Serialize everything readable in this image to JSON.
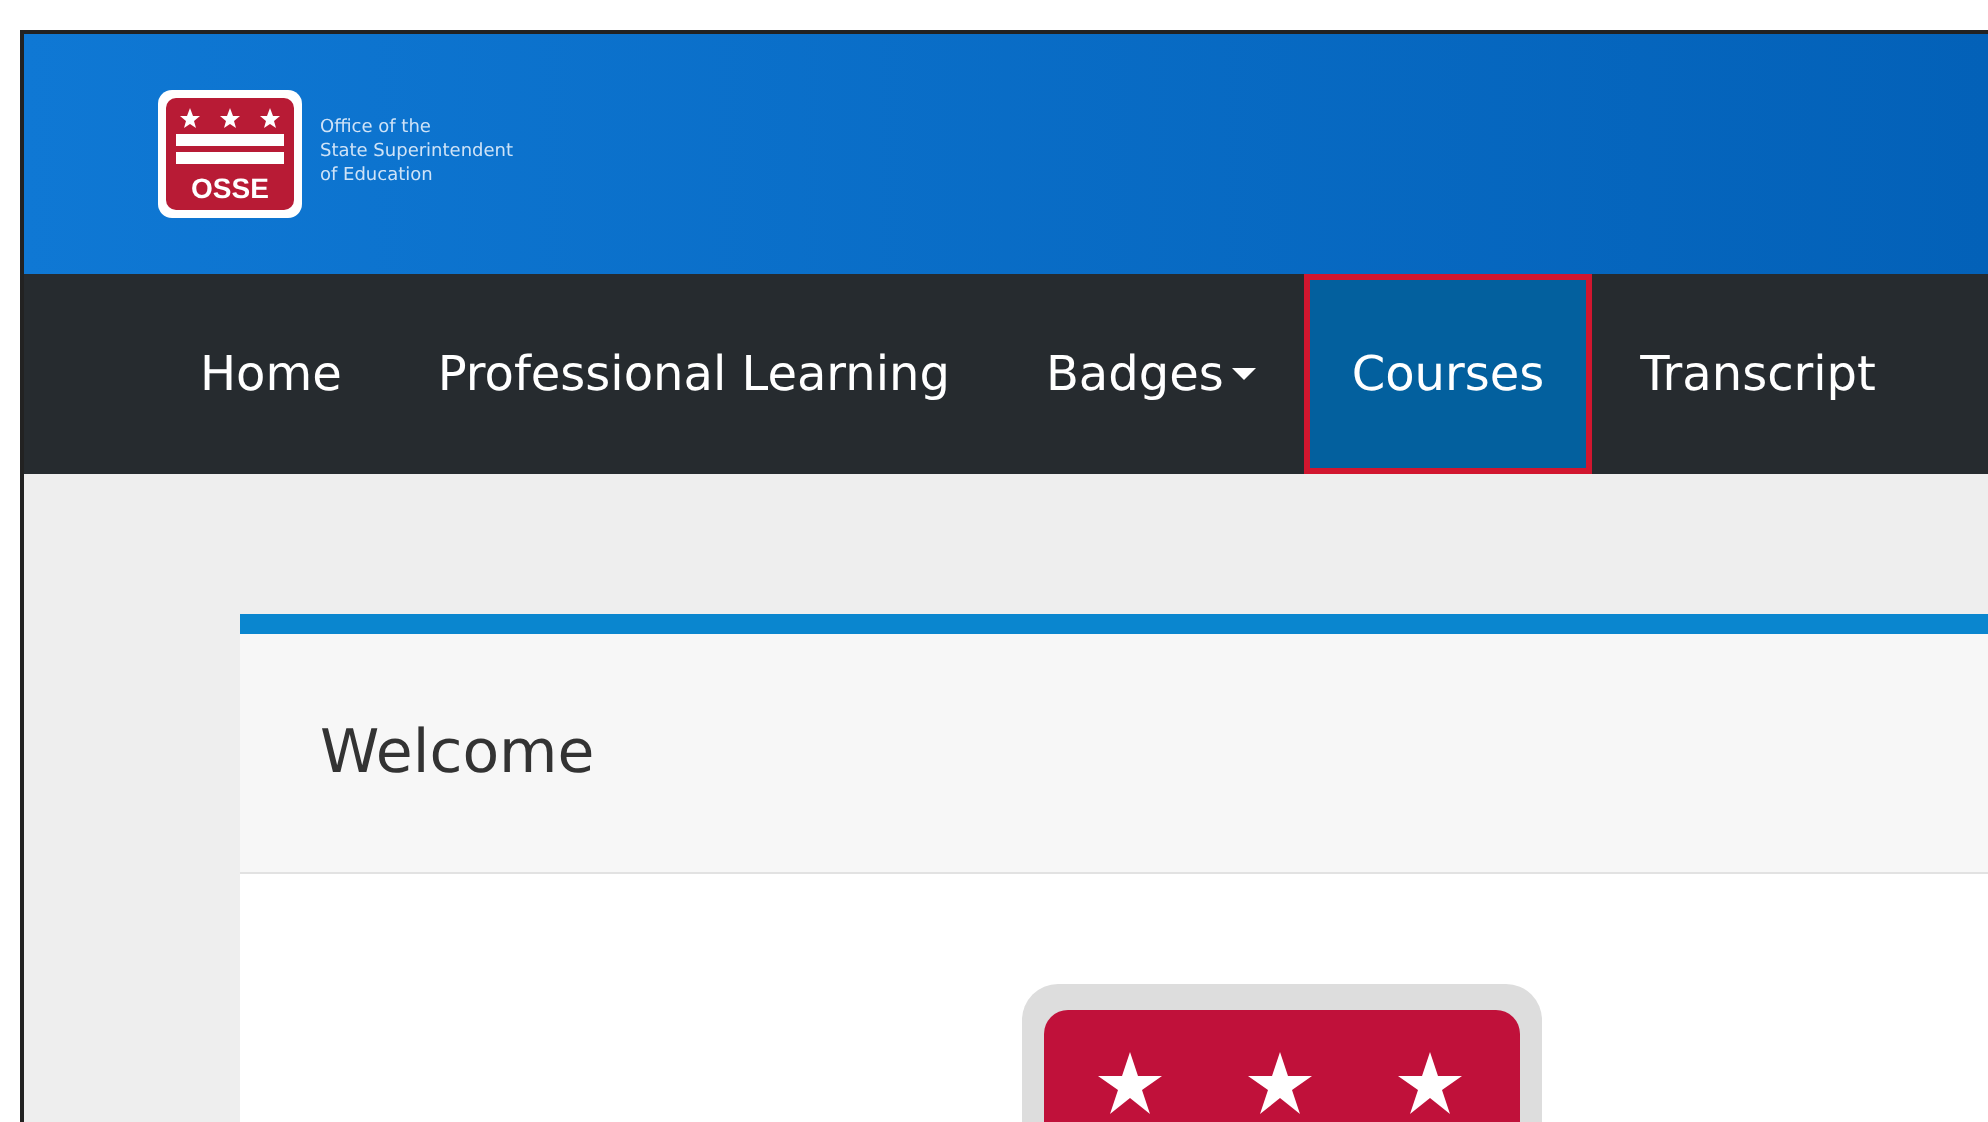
{
  "header": {
    "logo_text": "OSSE",
    "org_lines": [
      "Office of the",
      "State Superintendent",
      "of Education"
    ]
  },
  "nav": [
    {
      "label": "Home",
      "selected": false,
      "highlighted": false,
      "dropdown": false
    },
    {
      "label": "Professional Learning",
      "selected": false,
      "highlighted": false,
      "dropdown": false
    },
    {
      "label": "Badges",
      "selected": false,
      "highlighted": false,
      "dropdown": true
    },
    {
      "label": "Courses",
      "selected": true,
      "highlighted": true,
      "dropdown": false
    },
    {
      "label": "Transcript",
      "selected": false,
      "highlighted": false,
      "dropdown": false
    }
  ],
  "card": {
    "title": "Welcome"
  }
}
